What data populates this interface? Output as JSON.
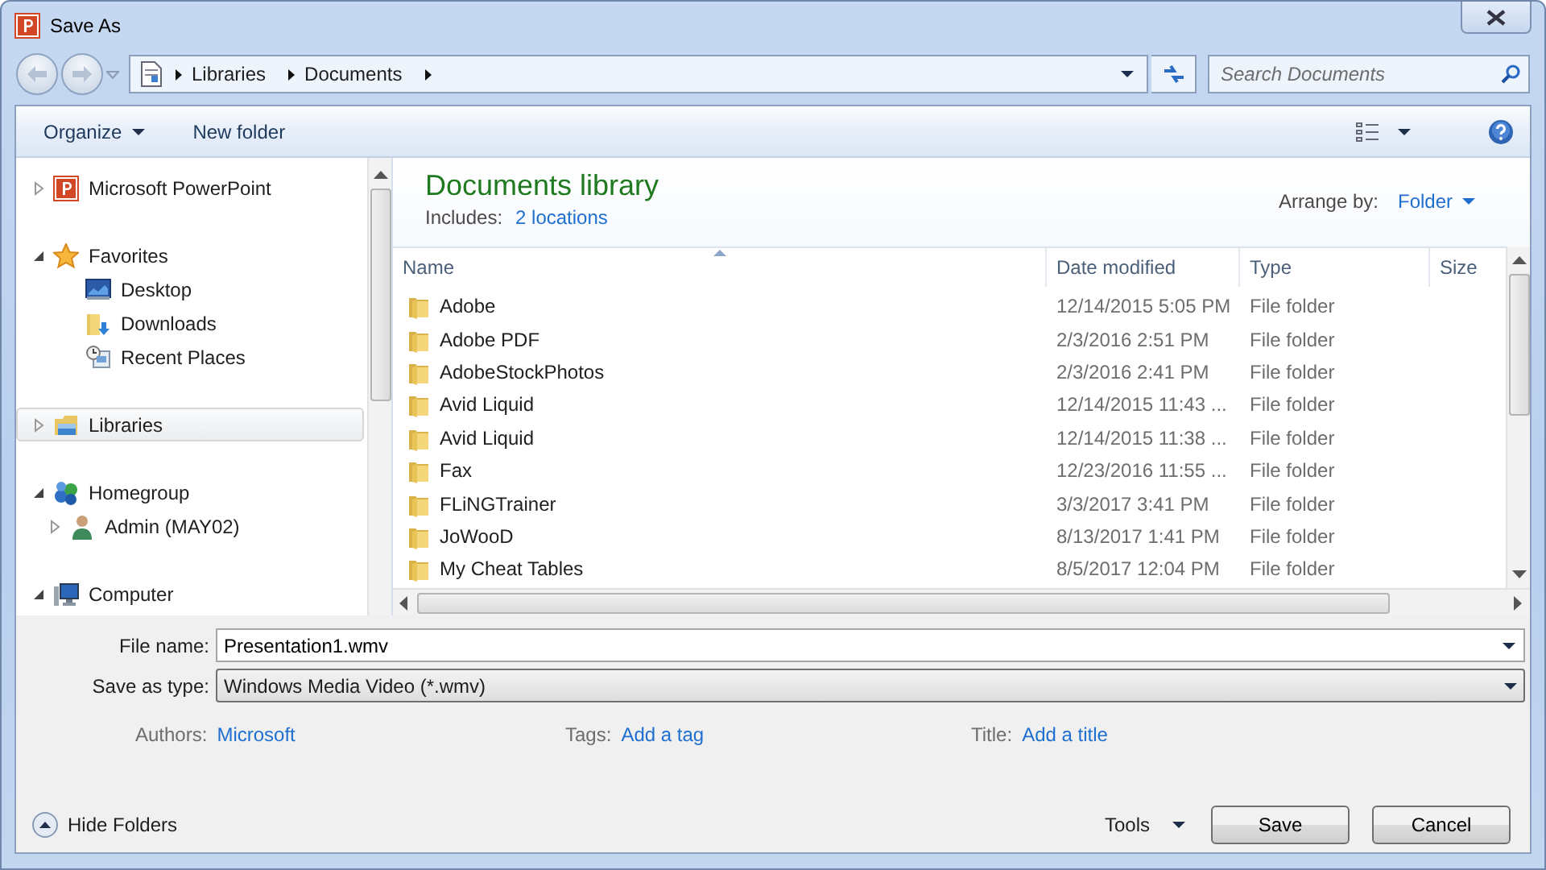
{
  "window": {
    "title": "Save As"
  },
  "address": {
    "breadcrumb": [
      "Libraries",
      "Documents"
    ]
  },
  "search": {
    "placeholder": "Search Documents"
  },
  "toolbar": {
    "organize": "Organize",
    "new_folder": "New folder"
  },
  "navigation": [
    {
      "label": "Microsoft PowerPoint",
      "kind": "powerpoint",
      "expanded": false,
      "selected": false
    },
    {
      "label": "Favorites",
      "kind": "star",
      "expanded": true,
      "selected": false,
      "children": [
        {
          "label": "Desktop",
          "kind": "desktop",
          "selected": false
        },
        {
          "label": "Downloads",
          "kind": "downloads",
          "selected": false
        },
        {
          "label": "Recent Places",
          "kind": "recent",
          "selected": false
        }
      ]
    },
    {
      "label": "Libraries",
      "kind": "library",
      "expanded": false,
      "selected": true
    },
    {
      "label": "Homegroup",
      "kind": "homegroup",
      "expanded": true,
      "selected": false,
      "children": [
        {
          "label": "Admin (MAY02)",
          "kind": "user",
          "expanded": false,
          "selected": false
        }
      ]
    },
    {
      "label": "Computer",
      "kind": "computer",
      "expanded": true,
      "selected": false
    }
  ],
  "library": {
    "title": "Documents library",
    "includes_label": "Includes:",
    "includes_link": "2 locations",
    "arrange_label": "Arrange by:",
    "arrange_value": "Folder"
  },
  "columns": [
    {
      "label": "Name",
      "sorted": true
    },
    {
      "label": "Date modified",
      "sorted": false
    },
    {
      "label": "Type",
      "sorted": false
    },
    {
      "label": "Size",
      "sorted": false
    }
  ],
  "rows": [
    {
      "name": "Adobe",
      "date": "12/14/2015 5:05 PM",
      "type": "File folder"
    },
    {
      "name": "Adobe PDF",
      "date": "2/3/2016 2:51 PM",
      "type": "File folder"
    },
    {
      "name": "AdobeStockPhotos",
      "date": "2/3/2016 2:41 PM",
      "type": "File folder"
    },
    {
      "name": "Avid Liquid",
      "date": "12/14/2015 11:43 ...",
      "type": "File folder"
    },
    {
      "name": "Avid Liquid",
      "date": "12/14/2015 11:38 ...",
      "type": "File folder"
    },
    {
      "name": "Fax",
      "date": "12/23/2016 11:55 ...",
      "type": "File folder"
    },
    {
      "name": "FLiNGTrainer",
      "date": "3/3/2017 3:41 PM",
      "type": "File folder"
    },
    {
      "name": "JoWooD",
      "date": "8/13/2017 1:41 PM",
      "type": "File folder"
    },
    {
      "name": "My Cheat Tables",
      "date": "8/5/2017 12:04 PM",
      "type": "File folder"
    }
  ],
  "fields": [
    {
      "label": "File name:",
      "value": "Presentation1.wmv",
      "kind": "combo"
    },
    {
      "label": "Save as type:",
      "value": "Windows Media Video (*.wmv)",
      "kind": "select"
    }
  ],
  "metadata": [
    {
      "label": "Authors:",
      "value": "Microsoft"
    },
    {
      "label": "Tags:",
      "value": "Add a tag"
    },
    {
      "label": "Title:",
      "value": "Add a title"
    }
  ],
  "hide_folders": "Hide Folders",
  "tools": "Tools",
  "buttons": [
    "Save",
    "Cancel"
  ]
}
